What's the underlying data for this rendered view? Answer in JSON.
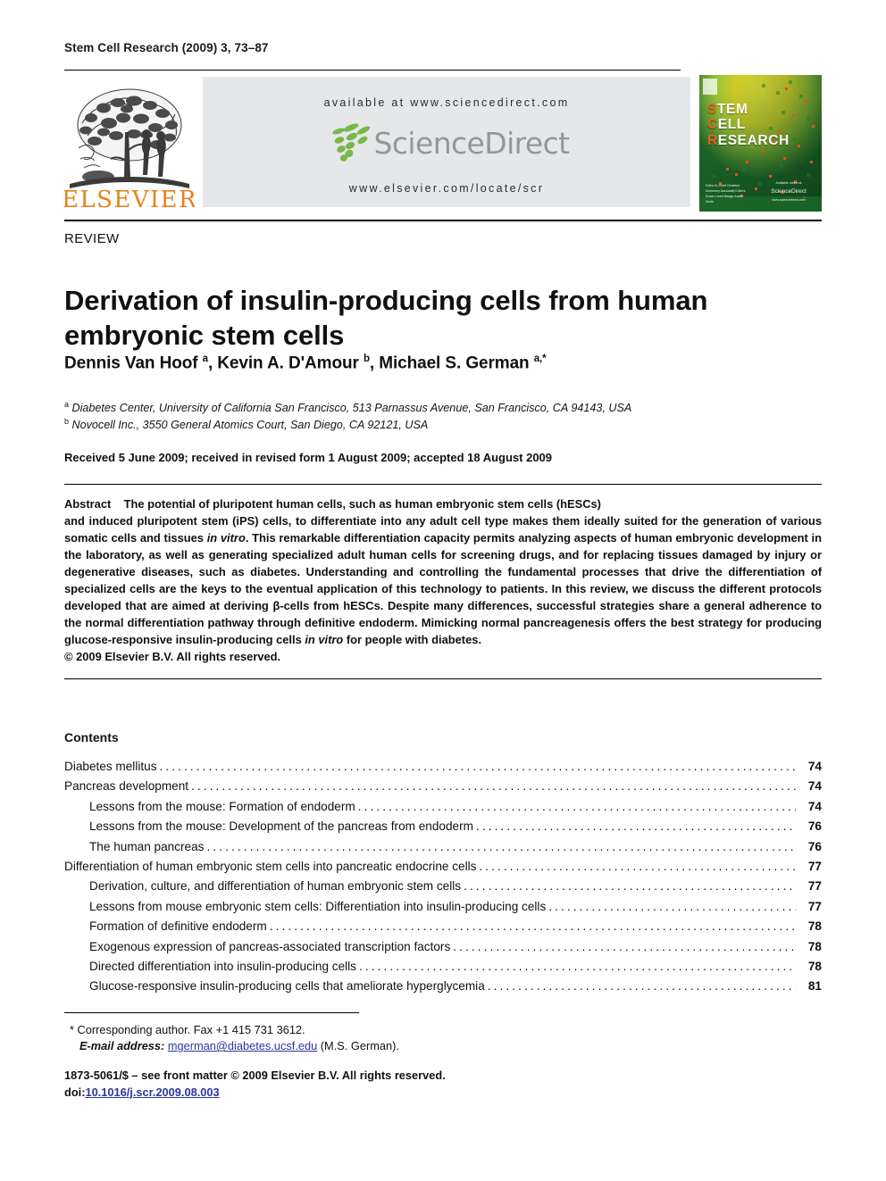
{
  "running_head": "Stem Cell Research (2009) 3, 73–87",
  "masthead": {
    "available_at": "available at www.sciencedirect.com",
    "sciencedirect_wordmark": "ScienceDirect",
    "journal_url": "www.elsevier.com/locate/scr",
    "publisher_name": "ELSEVIER",
    "publisher_logo_icon": "elsevier-tree-logo",
    "sciencedirect_logo_icon": "sciencedirect-leaves-icon"
  },
  "cover": {
    "line1_cap": "S",
    "line1_rest": "TEM",
    "line2_cap": "C",
    "line2_rest": "ELL",
    "line3_cap": "R",
    "line3_rest": "ESEARCH",
    "editor_block": "Editor-in-Chief\nChristine Mummery\n\nAssociate Editors\nRobin Lovell-Badge\nAustin Smith",
    "available_online": "Available online at",
    "sd_mark": "ScienceDirect",
    "sd_url": "www.sciencedirect.com"
  },
  "article": {
    "type_label": "REVIEW",
    "title": "Derivation of insulin-producing cells from human embryonic stem cells",
    "authors_html": "Dennis Van Hoof <sup>a</sup>, Kevin A. D'Amour <sup>b</sup>, Michael S. German <sup>a,</sup><sup>*</sup>",
    "affiliations": [
      {
        "marker": "a",
        "text": "Diabetes Center, University of California San Francisco, 513 Parnassus Avenue, San Francisco, CA 94143, USA"
      },
      {
        "marker": "b",
        "text": "Novocell Inc., 3550 General Atomics Court, San Diego, CA 92121, USA"
      }
    ],
    "history": "Received 5 June 2009; received in revised form 1 August 2009; accepted 18 August 2009"
  },
  "abstract": {
    "label": "Abstract",
    "line1": "The potential of pluripotent human cells, such as human embryonic stem cells (hESCs)",
    "body_a": "and induced pluripotent stem (iPS) cells, to differentiate into any adult cell type makes them ideally suited for the generation of various somatic cells and tissues ",
    "italic_1": "in vitro",
    "body_b": ". This remarkable differentiation capacity permits analyzing aspects of human embryonic development in the laboratory, as well as generating specialized adult human cells for screening drugs, and for replacing tissues damaged by injury or degenerative diseases, such as diabetes. Understanding and controlling the fundamental processes that drive the differentiation of specialized cells are the keys to the eventual application of this technology to patients. In this review, we discuss the different protocols developed that are aimed at deriving β-cells from hESCs. Despite many differences, successful strategies share a general adherence to the normal differentiation pathway through definitive endoderm. Mimicking normal pancreagenesis offers the best strategy for producing glucose-responsive insulin-producing cells ",
    "italic_2": "in vitro",
    "body_c": " for people with diabetes.",
    "copyright": "© 2009 Elsevier B.V. All rights reserved."
  },
  "contents": {
    "heading": "Contents",
    "entries": [
      {
        "label": "Diabetes mellitus",
        "page": "74",
        "level": 1
      },
      {
        "label": "Pancreas development",
        "page": "74",
        "level": 1
      },
      {
        "label": "Lessons from the mouse: Formation of endoderm",
        "page": "74",
        "level": 2
      },
      {
        "label": "Lessons from the mouse: Development of the pancreas from endoderm",
        "page": "76",
        "level": 2
      },
      {
        "label": "The human pancreas",
        "page": "76",
        "level": 2
      },
      {
        "label": "Differentiation of human embryonic stem cells into pancreatic endocrine cells",
        "page": "77",
        "level": 1
      },
      {
        "label": "Derivation, culture, and differentiation of human embryonic stem cells",
        "page": "77",
        "level": 2
      },
      {
        "label": "Lessons from mouse embryonic stem cells: Differentiation into insulin-producing cells",
        "page": "77",
        "level": 2
      },
      {
        "label": "Formation of definitive endoderm",
        "page": "78",
        "level": 2
      },
      {
        "label": "Exogenous expression of pancreas-associated transcription factors",
        "page": "78",
        "level": 2
      },
      {
        "label": "Directed differentiation into insulin-producing cells",
        "page": "78",
        "level": 2
      },
      {
        "label": "Glucose-responsive insulin-producing cells that ameliorate hyperglycemia",
        "page": "81",
        "level": 2
      }
    ]
  },
  "footer": {
    "corresponding_marker": "*",
    "corresponding": "Corresponding author. Fax +1 415 731 3612.",
    "email_label": "E-mail address:",
    "email": "mgerman@diabetes.ucsf.edu",
    "email_suffix": "(M.S. German).",
    "issn_line": "1873-5061/$ – see front matter © 2009 Elsevier B.V. All rights reserved.",
    "doi_label": "doi:",
    "doi": "10.1016/j.scr.2009.08.003"
  },
  "colors": {
    "elsevier_orange": "#e8821e",
    "link_blue": "#2b36a1",
    "banner_gray": "#e5e7e9",
    "sd_gray": "#949699",
    "sd_green": "#7ab648",
    "cover_green": "#2f7d32",
    "cover_accent_orange": "#e8621f"
  }
}
